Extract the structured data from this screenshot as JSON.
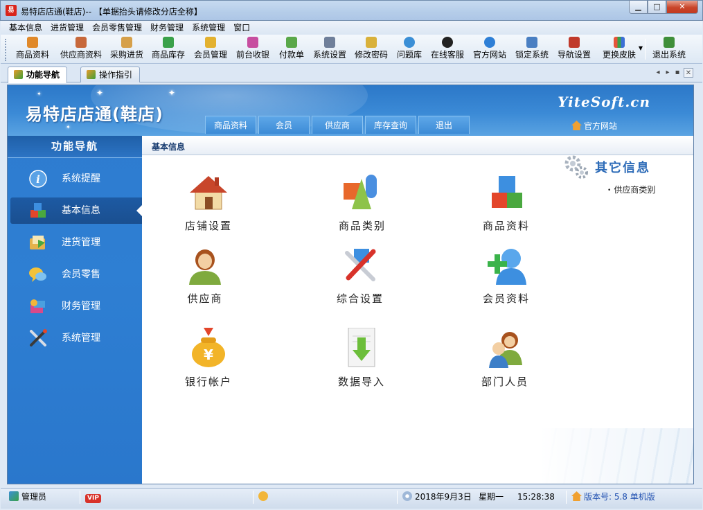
{
  "window": {
    "title": "易特店店通(鞋店)-- 【单据抬头请修改分店全称】",
    "app_icon_text": "易"
  },
  "menubar": [
    "基本信息",
    "进货管理",
    "会员零售管理",
    "财务管理",
    "系统管理",
    "窗口"
  ],
  "toolbar": [
    {
      "label": "商品资料",
      "icon": "goods-icon",
      "color": "#e0892a"
    },
    {
      "label": "供应商资料",
      "icon": "supplier-icon",
      "color": "#c7683b"
    },
    {
      "label": "采购进货",
      "icon": "truck-icon",
      "color": "#d6a04a"
    },
    {
      "label": "商品库存",
      "icon": "box-icon",
      "color": "#3aa14a"
    },
    {
      "label": "会员管理",
      "icon": "member-icon",
      "color": "#e3b12f"
    },
    {
      "label": "前台收银",
      "icon": "cashier-icon",
      "color": "#c74ea0"
    },
    {
      "label": "付款单",
      "icon": "payment-icon",
      "color": "#5aa84a"
    },
    {
      "label": "系统设置",
      "icon": "settings-icon",
      "color": "#6f7f9a"
    },
    {
      "label": "修改密码",
      "icon": "key-icon",
      "color": "#d9b13a"
    },
    {
      "label": "问题库",
      "icon": "question-icon",
      "color": "#3b8fd6"
    },
    {
      "label": "在线客服",
      "icon": "qq-icon",
      "color": "#222222"
    },
    {
      "label": "官方网站",
      "icon": "ie-icon",
      "color": "#2e7fd6"
    },
    {
      "label": "锁定系统",
      "icon": "lock-icon",
      "color": "#4a7fc2"
    },
    {
      "label": "导航设置",
      "icon": "nav-settings-icon",
      "color": "#c0392b"
    },
    {
      "label": "更换皮肤",
      "icon": "skin-icon",
      "color": "#e6553a"
    },
    {
      "label": "退出系统",
      "icon": "exit-icon",
      "color": "#3f8f3a"
    }
  ],
  "tabs": [
    {
      "label": "功能导航",
      "active": true
    },
    {
      "label": "操作指引",
      "active": false
    }
  ],
  "banner": {
    "title": "易特店店通(鞋店)",
    "brand": "YiteSoft.cn",
    "official_link": "官方网站",
    "tabs": [
      "商品资料",
      "会员",
      "供应商",
      "库存查询",
      "退出"
    ]
  },
  "leftnav": {
    "header": "功能导航",
    "items": [
      {
        "label": "系统提醒",
        "icon": "info-icon",
        "selected": false
      },
      {
        "label": "基本信息",
        "icon": "cubes-icon",
        "selected": true
      },
      {
        "label": "进货管理",
        "icon": "folder-icon",
        "selected": false
      },
      {
        "label": "会员零售",
        "icon": "chat-icon",
        "selected": false
      },
      {
        "label": "财务管理",
        "icon": "finance-icon",
        "selected": false
      },
      {
        "label": "系统管理",
        "icon": "tools-icon",
        "selected": false
      }
    ]
  },
  "main": {
    "header": "基本信息",
    "tiles": [
      {
        "label": "店铺设置",
        "icon": "house-icon"
      },
      {
        "label": "商品类别",
        "icon": "shapes-icon"
      },
      {
        "label": "商品资料",
        "icon": "cubes-icon"
      },
      {
        "label": "供应商",
        "icon": "person-icon"
      },
      {
        "label": "综合设置",
        "icon": "tools-icon"
      },
      {
        "label": "会员资料",
        "icon": "add-member-icon"
      },
      {
        "label": "银行帐户",
        "icon": "money-bag-icon"
      },
      {
        "label": "数据导入",
        "icon": "import-icon"
      },
      {
        "label": "部门人员",
        "icon": "staff-icon"
      }
    ],
    "other": {
      "title": "其它信息",
      "links": [
        "供应商类别"
      ]
    }
  },
  "statusbar": {
    "user": "管理员",
    "vip": "VIP",
    "date": "2018年9月3日",
    "weekday": "星期一",
    "time": "15:28:38",
    "version": "版本号: 5.8 单机版"
  }
}
